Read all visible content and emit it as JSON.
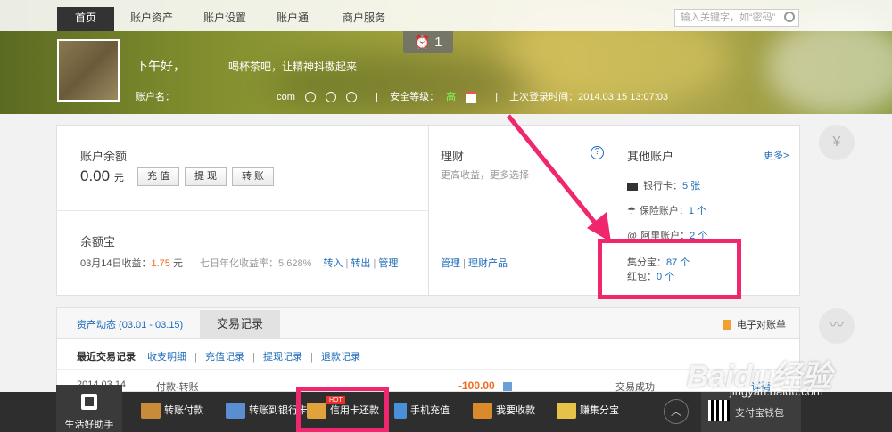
{
  "nav": {
    "items": [
      "首页",
      "账户资产",
      "账户设置",
      "账户通",
      "商户服务"
    ],
    "search_placeholder": "输入关键字，如“密码”"
  },
  "header": {
    "notify_count": "1",
    "greeting": "下午好，",
    "greeting_tail": "喝杯茶吧，让精神抖擞起来",
    "account_label": "账户名：",
    "account_suffix": "com",
    "security_label": "安全等级：",
    "security_level": "高",
    "last_login_label": "上次登录时间：",
    "last_login": "2014.03.15 13:07:03"
  },
  "balance": {
    "title": "账户余额",
    "amount": "0.00",
    "unit": "元",
    "btn_recharge": "充 值",
    "btn_withdraw": "提 现",
    "btn_transfer": "转 账"
  },
  "yuebao": {
    "title": "余额宝",
    "income_label": "03月14日收益：",
    "income": "1.75",
    "unit": "元",
    "rate_label": "七日年化收益率：5.628%",
    "link_in": "转入",
    "link_out": "转出",
    "link_manage": "管理"
  },
  "licai": {
    "title": "理财",
    "subtitle": "更高收益，更多选择",
    "help": "?",
    "link_manage": "管理",
    "link_products": "理财产品"
  },
  "other": {
    "title": "其他账户",
    "more": "更多>",
    "bank_label": "银行卡：",
    "bank_value": "5 张",
    "insurance_label": "保险账户：",
    "insurance_value": "1 个",
    "ali_label": "阿里账户：",
    "ali_value": "2 个",
    "points_label": "集分宝：",
    "points_value": "87 个",
    "hongbao_label": "红包：",
    "hongbao_value": "0 个"
  },
  "tabs": {
    "asset_dynamic": "资产动态 (03.01 - 03.15)",
    "trade_record": "交易记录",
    "ebill": "电子对账单"
  },
  "records": {
    "head": "最近交易记录",
    "links": [
      "收支明细",
      "充值记录",
      "提现记录",
      "退款记录"
    ],
    "row": {
      "date": "2014.03.14",
      "desc": "付款-转账",
      "amount": "-100.00",
      "status": "交易成功",
      "detail": "详情"
    }
  },
  "bottom": {
    "life_helper": "生活好助手",
    "items": [
      "转账付款",
      "转账到银行卡",
      "信用卡还款",
      "手机充值",
      "我要收款",
      "赚集分宝"
    ],
    "hot": "HOT",
    "wallet": "支付宝钱包"
  },
  "watermark": {
    "brand": "Baidu经验",
    "url": "jingyan.baidu.com"
  }
}
